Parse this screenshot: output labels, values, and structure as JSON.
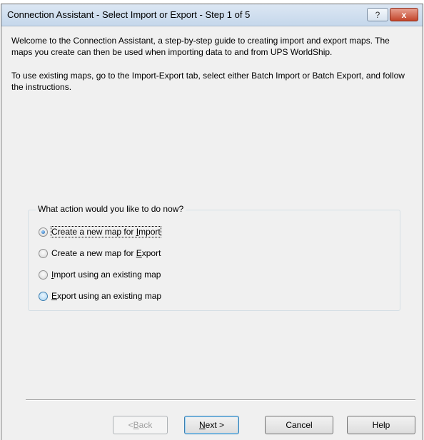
{
  "window": {
    "title": "Connection Assistant - Select Import or Export - Step 1 of 5",
    "help_glyph": "?",
    "close_glyph": "x"
  },
  "intro": {
    "paragraph1": "Welcome to the Connection Assistant, a step-by-step guide to creating import and export maps.  The maps you create can then be used when importing data to and from UPS WorldShip.",
    "paragraph2": "To use existing maps, go to the Import-Export tab, select either Batch Import or Batch Export, and follow the instructions."
  },
  "actions": {
    "group_label": "What action would you like to do now?",
    "options": [
      {
        "pre": "Create a new map for ",
        "key": "I",
        "post": "mport",
        "checked": true
      },
      {
        "pre": "Create a new map for ",
        "key": "E",
        "post": "xport",
        "checked": false
      },
      {
        "pre": "",
        "key": "I",
        "post": "mport using an existing map",
        "checked": false
      },
      {
        "pre": "",
        "key": "E",
        "post": "xport using an existing map",
        "checked": false
      }
    ]
  },
  "buttons": {
    "back": {
      "pre": "< ",
      "key": "B",
      "post": "ack"
    },
    "next": {
      "pre": "",
      "key": "N",
      "post": "ext >"
    },
    "cancel": "Cancel",
    "help": "Help"
  },
  "colors": {
    "titlebar": "#c5d7eb",
    "close_button": "#c3452b",
    "dialog_background": "#f0f0f0"
  }
}
